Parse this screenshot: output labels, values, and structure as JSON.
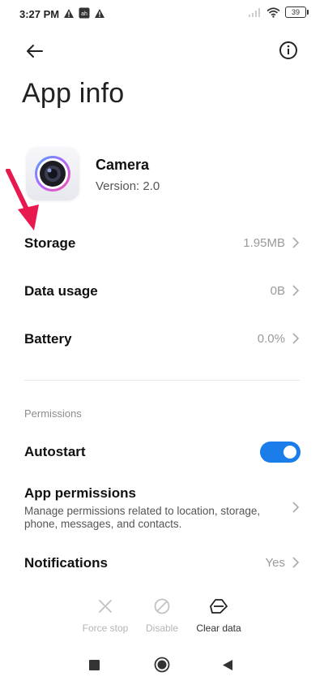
{
  "status_bar": {
    "time": "3:27 PM",
    "battery_level": "39",
    "icons": [
      "warning-icon",
      "notification-app-icon",
      "warning-icon",
      "signal-icon",
      "wifi-icon",
      "battery-icon"
    ]
  },
  "header": {
    "back_icon": "arrow-left-icon",
    "info_icon": "info-icon",
    "title": "App info"
  },
  "app": {
    "name": "Camera",
    "version": "Version: 2.0",
    "icon": "camera-icon"
  },
  "annotation": {
    "icon": "red-arrow-pointer"
  },
  "rows": {
    "storage": {
      "label": "Storage",
      "value": "1.95MB"
    },
    "data_usage": {
      "label": "Data usage",
      "value": "0B"
    },
    "battery": {
      "label": "Battery",
      "value": "0.0%"
    }
  },
  "permissions_section": {
    "header": "Permissions",
    "autostart": {
      "label": "Autostart",
      "enabled": true
    },
    "app_permissions": {
      "label": "App permissions",
      "description": "Manage permissions related to location, storage, phone, messages, and contacts."
    },
    "notifications": {
      "label": "Notifications",
      "value": "Yes"
    }
  },
  "actions": {
    "force_stop": {
      "label": "Force stop",
      "enabled": false
    },
    "disable": {
      "label": "Disable",
      "enabled": false
    },
    "clear_data": {
      "label": "Clear data",
      "enabled": true
    }
  },
  "nav_bar": {
    "icons": [
      "recents-square-icon",
      "home-circle-icon",
      "back-triangle-icon"
    ]
  },
  "colors": {
    "accent": "#1a7dea",
    "annotation": "#e8194f",
    "muted": "#9a9a9a"
  }
}
